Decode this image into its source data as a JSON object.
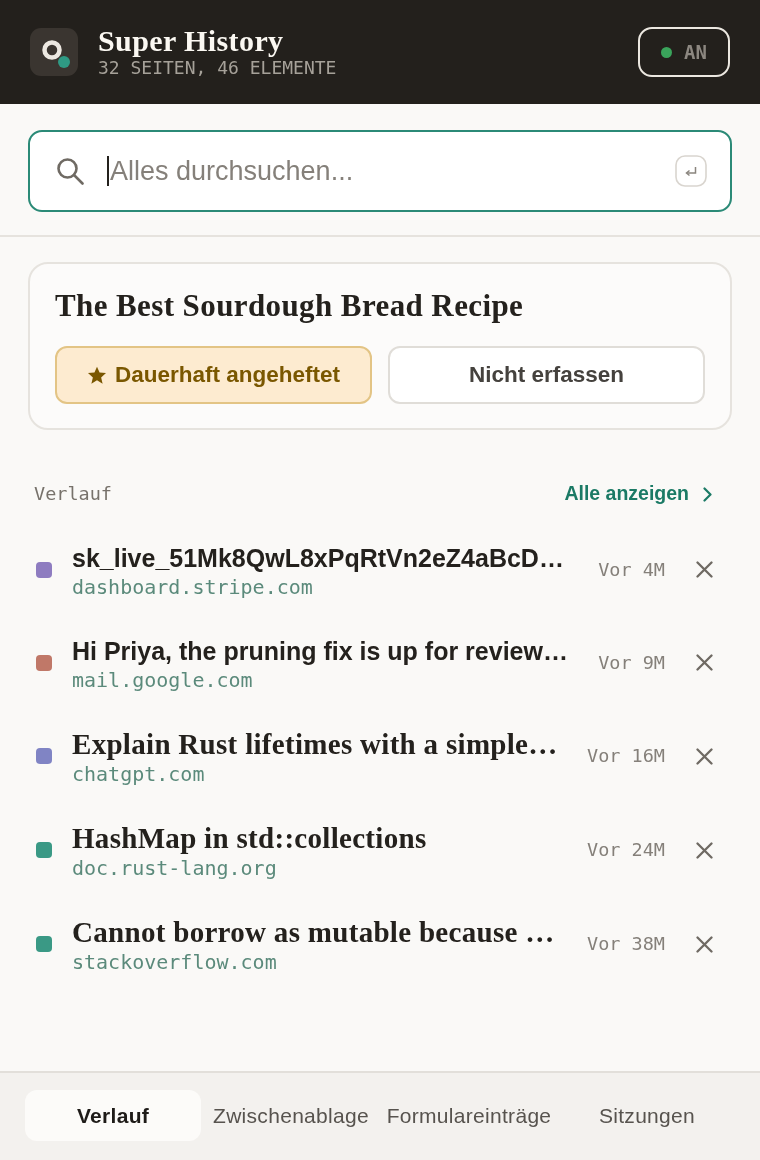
{
  "header": {
    "title": "Super History",
    "subtitle": "32 SEITEN, 46 ELEMENTE",
    "toggle": {
      "label": "AN",
      "on": true
    }
  },
  "search": {
    "placeholder": "Alles durchsuchen...",
    "focused": true
  },
  "current_page": {
    "title": "The Best Sourdough Bread Recipe",
    "actions": [
      {
        "label": "Dauerhaft angeheftet",
        "on": true
      },
      {
        "label": "Nicht erfassen",
        "on": false
      }
    ]
  },
  "history": {
    "heading": "Verlauf",
    "link": "Alle anzeigen",
    "items": [
      {
        "kind": "text",
        "title": "sk_live_51Mk8QwL8xPqRtVn2eZ4aBcD…",
        "domain": "dashboard.stripe.com",
        "time": "Vor 4M",
        "color": "#8e7cc0"
      },
      {
        "kind": "text",
        "title": "Hi Priya, the pruning fix is up for review…",
        "domain": "mail.google.com",
        "time": "Vor 9M",
        "color": "#c07868"
      },
      {
        "kind": "page",
        "title": "Explain Rust lifetimes with a simple…",
        "domain": "chatgpt.com",
        "time": "Vor 16M",
        "color": "#8084c4"
      },
      {
        "kind": "page",
        "title": "HashMap in std::collections",
        "domain": "doc.rust-lang.org",
        "time": "Vor 24M",
        "color": "#3a9985"
      },
      {
        "kind": "page",
        "title": "Cannot borrow as mutable because …",
        "domain": "stackoverflow.com",
        "time": "Vor 38M",
        "color": "#3a9985"
      }
    ]
  },
  "tabs": [
    {
      "label": "Verlauf",
      "selected": true
    },
    {
      "label": "Zwischenablage",
      "selected": false
    },
    {
      "label": "Formulareinträge",
      "selected": false
    },
    {
      "label": "Sitzungen",
      "selected": false
    }
  ]
}
